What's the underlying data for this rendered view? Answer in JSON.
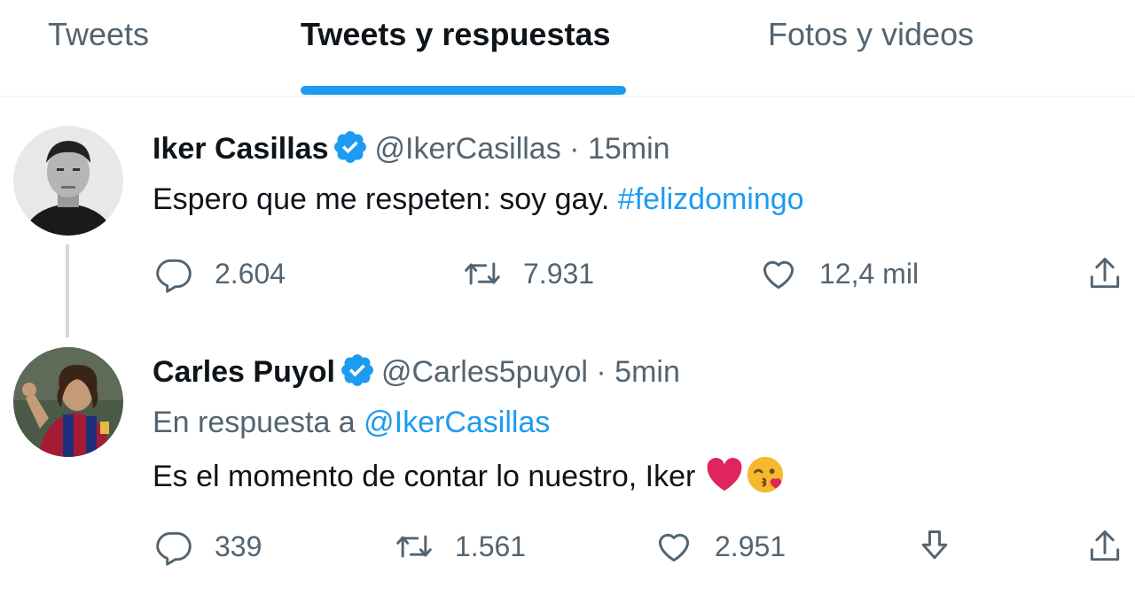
{
  "tabs": [
    {
      "label": "Tweets"
    },
    {
      "label": "Tweets y respuestas"
    },
    {
      "label": "Fotos y videos"
    }
  ],
  "tweets": [
    {
      "name": "Iker Casillas",
      "handle": "@IkerCasillas",
      "separator": "·",
      "time": "15min",
      "text": "Espero que me respeten: soy gay.",
      "hashtag": "#felizdomingo",
      "replies": "2.604",
      "retweets": "7.931",
      "likes": "12,4 mil"
    },
    {
      "name": "Carles Puyol",
      "handle": "@Carles5puyol",
      "separator": "·",
      "time": "5min",
      "reply_prefix": "En respuesta a",
      "reply_handle": "@IkerCasillas",
      "text": "Es el momento de contar lo nuestro, Iker",
      "replies": "339",
      "retweets": "1.561",
      "likes": "2.951"
    }
  ],
  "icons": {
    "verified": "verified-badge-icon",
    "reply": "reply-icon",
    "retweet": "retweet-icon",
    "like": "heart-icon",
    "share": "share-icon",
    "download": "download-icon"
  },
  "colors": {
    "accent": "#1d9bf0",
    "text": "#0f1419",
    "muted": "#536471",
    "heart_emoji": "#e0245e",
    "kiss_emoji": "#f5b82e"
  }
}
